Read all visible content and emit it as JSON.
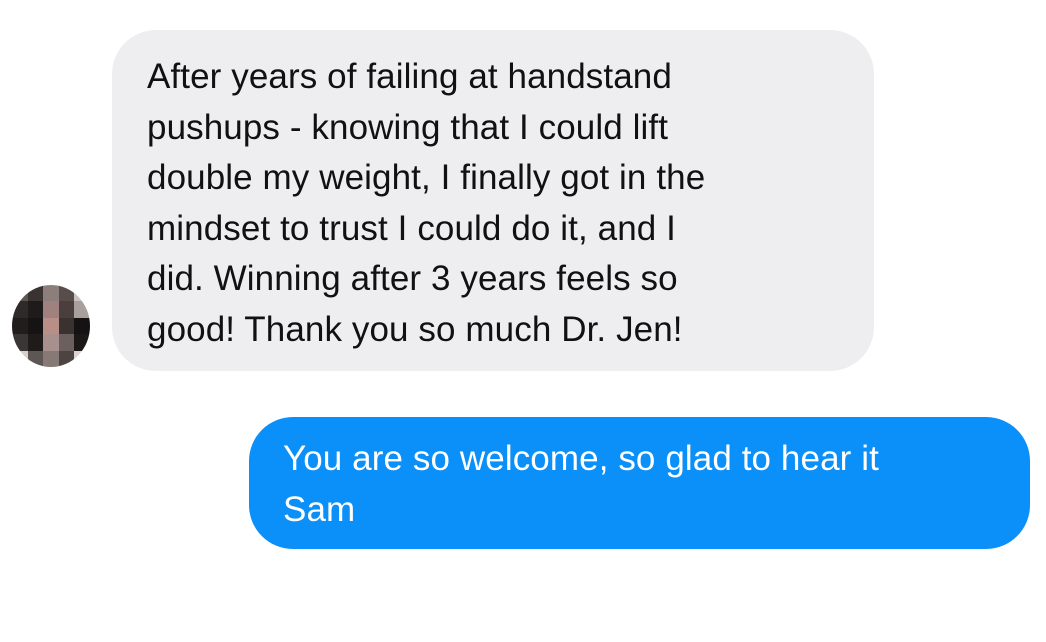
{
  "conversation": {
    "messages": [
      {
        "sender": "contact",
        "text": "After years of failing at handstand\npushups - knowing that I could lift\ndouble my weight, I finally got in the\nmindset to trust I could do it, and I\ndid. Winning after 3 years feels so\ngood! Thank you so much Dr. Jen!"
      },
      {
        "sender": "me",
        "text": "You are so welcome, so glad to hear it\nSam"
      }
    ]
  },
  "colors": {
    "incoming_bubble": "#eeedef",
    "outgoing_bubble": "#0b8ff8",
    "incoming_text": "#111111",
    "outgoing_text": "#ffffff"
  },
  "avatar": {
    "icon": "pixelated-avatar-icon"
  }
}
